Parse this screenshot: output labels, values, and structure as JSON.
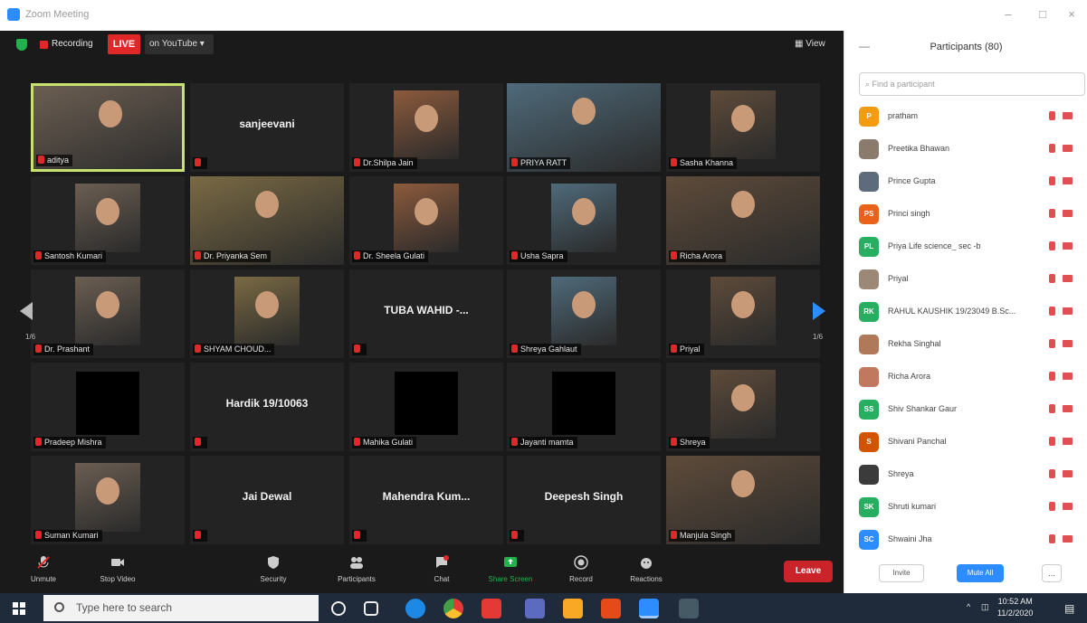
{
  "window": {
    "title": "Zoom Meeting",
    "buttons": [
      "–",
      "□",
      "×"
    ]
  },
  "topbar": {
    "recording": "Recording",
    "live": "LIVE",
    "stream_target": "on YouTube ▾",
    "view": "View"
  },
  "tiles": [
    {
      "name": "aditya",
      "style": "video",
      "active": true
    },
    {
      "name": "sanjeevani",
      "style": "text"
    },
    {
      "name": "Dr.Shilpa Jain",
      "style": "video"
    },
    {
      "name": "PRIYA RATT",
      "style": "video"
    },
    {
      "name": "Sasha Khanna",
      "style": "video"
    },
    {
      "name": "Santosh Kumari",
      "style": "video"
    },
    {
      "name": "Dr. Priyanka Sem",
      "style": "video"
    },
    {
      "name": "Dr. Sheela Gulati",
      "style": "video"
    },
    {
      "name": "Usha Sapra",
      "style": "video"
    },
    {
      "name": "Richa Arora",
      "style": "video"
    },
    {
      "name": "Dr. Prashant",
      "style": "video"
    },
    {
      "name": "SHYAM CHOUD...",
      "style": "video"
    },
    {
      "name": "TUBA WAHID -...",
      "style": "text",
      "label": ""
    },
    {
      "name": "Shreya Gahlaut",
      "style": "video"
    },
    {
      "name": "Priyal",
      "style": "video"
    },
    {
      "name": "Pradeep Mishra",
      "style": "black"
    },
    {
      "name": "Hardik 19/10063",
      "style": "text",
      "label": ""
    },
    {
      "name": "Mahika Gulati",
      "style": "black"
    },
    {
      "name": "Jayanti mamta",
      "style": "black"
    },
    {
      "name": "Shreya",
      "style": "video"
    },
    {
      "name": "Suman Kumari",
      "style": "video"
    },
    {
      "name": "Jai Dewal",
      "style": "text",
      "label": ""
    },
    {
      "name": "Mahendra  Kum...",
      "style": "text",
      "label": ""
    },
    {
      "name": "Deepesh Singh",
      "style": "text",
      "label": ""
    },
    {
      "name": "Manjula Singh",
      "style": "video"
    }
  ],
  "pager": {
    "left": "1/6",
    "right": "1/6"
  },
  "toolbar": {
    "unmute": "Unmute",
    "stop_video": "Stop Video",
    "security": "Security",
    "participants": "Participants",
    "participants_count": "80",
    "chat": "Chat",
    "share": "Share Screen",
    "record": "Record",
    "reactions": "Reactions",
    "leave": "Leave"
  },
  "panel": {
    "title": "Participants (80)",
    "search_placeholder": "Find a participant",
    "invite": "Invite",
    "mute_all": "Mute All",
    "more": "...",
    "participants": [
      {
        "initials": "P",
        "name": "pratham",
        "color": "#f39c12"
      },
      {
        "initials": "",
        "name": "Preetika Bhawan",
        "color": "#8a7b6d"
      },
      {
        "initials": "",
        "name": "Prince Gupta",
        "color": "#5d6b7c"
      },
      {
        "initials": "PS",
        "name": "Princi singh",
        "color": "#e8621c"
      },
      {
        "initials": "PL",
        "name": "Priya Life science_ sec -b",
        "color": "#27ae60"
      },
      {
        "initials": "",
        "name": "Priyal",
        "color": "#9b8877"
      },
      {
        "initials": "RK",
        "name": "RAHUL KAUSHIK 19/23049 B.Sc...",
        "color": "#27ae60"
      },
      {
        "initials": "",
        "name": "Rekha Singhal",
        "color": "#b07a5a"
      },
      {
        "initials": "",
        "name": "Richa Arora",
        "color": "#c0785e"
      },
      {
        "initials": "SS",
        "name": "Shiv Shankar Gaur",
        "color": "#27ae60"
      },
      {
        "initials": "S",
        "name": "Shivani Panchal",
        "color": "#d35400"
      },
      {
        "initials": "",
        "name": "Shreya",
        "color": "#3b3b3b"
      },
      {
        "initials": "SK",
        "name": "Shruti kumari",
        "color": "#27ae60"
      },
      {
        "initials": "SC",
        "name": "Shwaini Jha",
        "color": "#2d8cff"
      }
    ]
  },
  "taskbar": {
    "search_placeholder": "Type here to search",
    "time": "10:52 AM",
    "date": "11/2/2020"
  }
}
